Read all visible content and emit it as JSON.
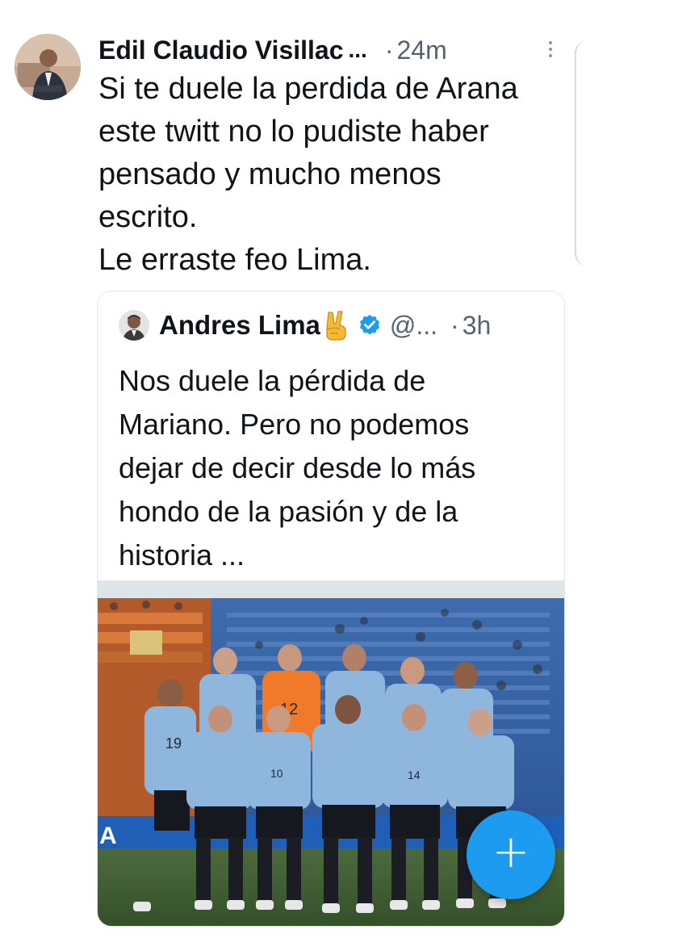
{
  "tweet": {
    "author_name": "Edil Claudio Visillac",
    "author_truncation": "...",
    "separator": "·",
    "time": "24m",
    "text_lines": [
      "Si te duele la perdida de Arana",
      "este twitt no lo pudiste haber",
      "pensado y mucho menos",
      "escrito.",
      "Le erraste feo Lima."
    ]
  },
  "quoted": {
    "author_name": "Andres Lima",
    "emoji": "victory-hand",
    "handle": "@...",
    "separator": "·",
    "time": "3h",
    "text_lines": [
      "Nos duele la pérdida de",
      "Mariano. Pero no podemos",
      "dejar de decir desde lo más",
      "hondo de la pasión y de la",
      "historia ..."
    ]
  },
  "fab": {
    "label": "+"
  },
  "colors": {
    "accent": "#1d9bf0",
    "text_primary": "#0f1419",
    "text_secondary": "#536471",
    "jersey": "#8fb6dc"
  },
  "icons": [
    "more-icon",
    "verified-icon",
    "victory-hand-emoji",
    "plus-icon"
  ]
}
